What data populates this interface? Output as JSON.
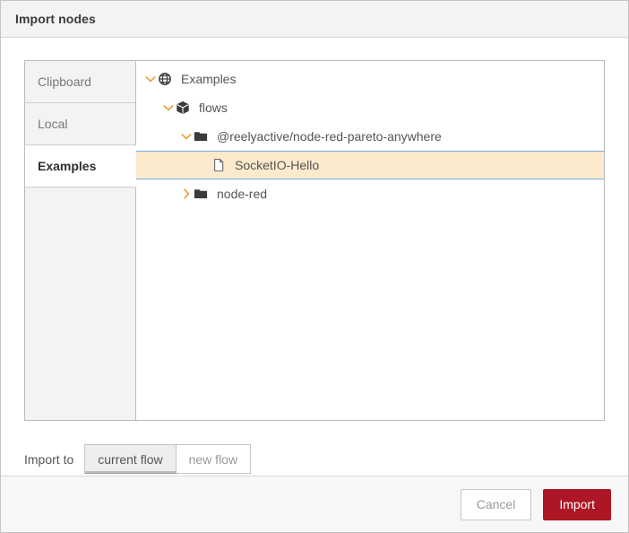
{
  "dialog": {
    "title": "Import nodes"
  },
  "sidebar": {
    "tabs": [
      {
        "label": "Clipboard",
        "name": "tab-clipboard",
        "active": false
      },
      {
        "label": "Local",
        "name": "tab-local",
        "active": false
      },
      {
        "label": "Examples",
        "name": "tab-examples",
        "active": true
      }
    ]
  },
  "tree": {
    "rows": [
      {
        "label": "Examples",
        "icon": "globe-icon",
        "twisty": "chevron-down-icon",
        "depth": 0,
        "selected": false,
        "expanded": true
      },
      {
        "label": "flows",
        "icon": "package-cube-icon",
        "twisty": "chevron-down-icon",
        "depth": 1,
        "selected": false,
        "expanded": true
      },
      {
        "label": "@reelyactive/node-red-pareto-anywhere",
        "icon": "folder-icon",
        "twisty": "chevron-down-icon",
        "depth": 2,
        "selected": false,
        "expanded": true
      },
      {
        "label": "SocketIO-Hello",
        "icon": "file-icon",
        "twisty": "none",
        "depth": 3,
        "selected": true,
        "expanded": false
      },
      {
        "label": "node-red",
        "icon": "folder-icon",
        "twisty": "chevron-right-icon",
        "depth": 2,
        "selected": false,
        "expanded": false
      }
    ]
  },
  "import_to": {
    "label": "Import to",
    "options": [
      {
        "label": "current flow",
        "name": "import-to-current-flow",
        "selected": true
      },
      {
        "label": "new flow",
        "name": "import-to-new-flow",
        "selected": false
      }
    ]
  },
  "footer": {
    "cancel_label": "Cancel",
    "import_label": "Import"
  },
  "colors": {
    "primary_red": "#ad1625",
    "selection_fill": "#fbeacc",
    "selection_border": "#7aaddc",
    "twisty": "#e8a33d",
    "titlebar_bg": "#f3f3f3"
  }
}
